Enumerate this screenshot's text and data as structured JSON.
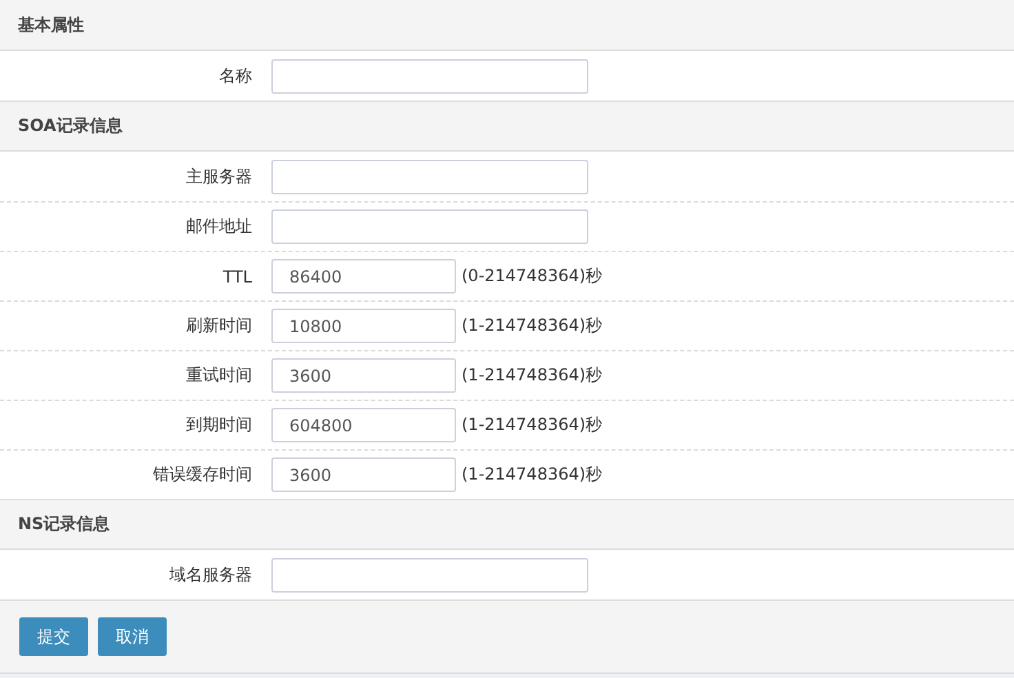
{
  "sections": [
    {
      "title": "基本属性",
      "fields": [
        {
          "label": "名称",
          "kind": "text"
        }
      ]
    },
    {
      "title": "SOA记录信息",
      "fields": [
        {
          "label": "主服务器",
          "kind": "text"
        },
        {
          "label": "邮件地址",
          "kind": "text"
        },
        {
          "label": "TTL",
          "value": "86400",
          "kind": "number",
          "hint": "(0-214748364)秒"
        },
        {
          "label": "刷新时间",
          "value": "10800",
          "kind": "number",
          "hint": "(1-214748364)秒"
        },
        {
          "label": "重试时间",
          "value": "3600",
          "kind": "number",
          "hint": "(1-214748364)秒"
        },
        {
          "label": "到期时间",
          "value": "604800",
          "kind": "number",
          "hint": "(1-214748364)秒"
        },
        {
          "label": "错误缓存时间",
          "value": "3600",
          "kind": "number",
          "hint": "(1-214748364)秒"
        }
      ]
    },
    {
      "title": "NS记录信息",
      "fields": [
        {
          "label": "域名服务器",
          "kind": "text"
        }
      ]
    }
  ],
  "buttons": [
    "提交",
    "取消"
  ]
}
